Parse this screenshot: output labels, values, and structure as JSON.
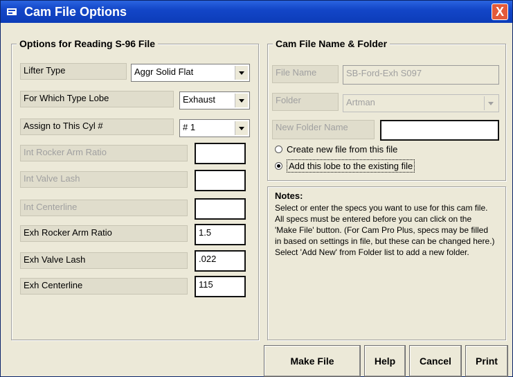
{
  "window": {
    "title": "Cam File Options",
    "close_label": "X"
  },
  "left_group": {
    "title": "Options for Reading S-96 File",
    "lifter_type": {
      "label": "Lifter Type",
      "value": "Aggr Solid Flat"
    },
    "lobe_type": {
      "label": "For Which Type Lobe",
      "value": "Exhaust"
    },
    "cyl": {
      "label": "Assign to This Cyl #",
      "value": "# 1"
    },
    "int_rocker": {
      "label": "Int Rocker Arm Ratio",
      "value": ""
    },
    "int_lash": {
      "label": "Int Valve Lash",
      "value": ""
    },
    "int_centerline": {
      "label": "Int Centerline",
      "value": ""
    },
    "exh_rocker": {
      "label": "Exh Rocker Arm Ratio",
      "value": "1.5"
    },
    "exh_lash": {
      "label": "Exh Valve Lash",
      "value": ".022"
    },
    "exh_centerline": {
      "label": "Exh Centerline",
      "value": "115"
    }
  },
  "right_group": {
    "title": "Cam File Name & Folder",
    "file_name": {
      "label": "File Name",
      "value": "SB-Ford-Exh S097"
    },
    "folder": {
      "label": "Folder",
      "value": "Artman"
    },
    "new_folder": {
      "label": "New Folder Name",
      "value": ""
    },
    "radio_create": "Create new file from this file",
    "radio_add": "Add this lobe to the existing file"
  },
  "notes": {
    "title": "Notes:",
    "text": "Select or enter the specs you want to use for this cam file.  All specs must be entered before you can click on the 'Make File' button.  (For Cam Pro Plus, specs may be filled in based on settings in file, but these can be changed here.)  Select 'Add New' from Folder list to add a new folder."
  },
  "buttons": {
    "make_file": "Make File",
    "help": "Help",
    "cancel": "Cancel",
    "print": "Print"
  },
  "colors": {
    "titlebar": "#1346c8",
    "dialog_bg": "#ece9d8",
    "close": "#e35a3a"
  }
}
